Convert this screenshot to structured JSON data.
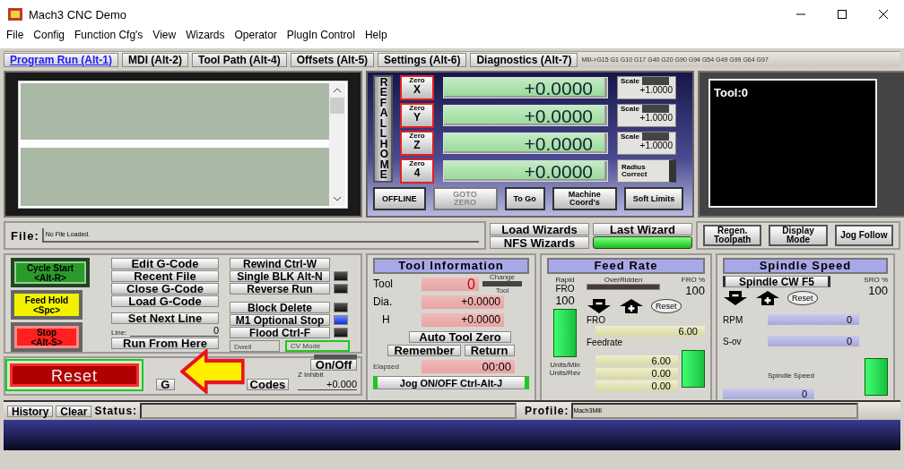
{
  "window": {
    "title": "Mach3 CNC  Demo"
  },
  "menu": [
    "File",
    "Config",
    "Function Cfg's",
    "View",
    "Wizards",
    "Operator",
    "PlugIn Control",
    "Help"
  ],
  "tabs": [
    {
      "label": "Program Run (Alt-1)",
      "selected": true
    },
    {
      "label": "MDI (Alt-2)",
      "selected": false
    },
    {
      "label": "Tool Path (Alt-4)",
      "selected": false
    },
    {
      "label": "Offsets (Alt-5)",
      "selected": false
    },
    {
      "label": "Settings (Alt-6)",
      "selected": false
    },
    {
      "label": "Diagnostics (Alt-7)",
      "selected": false
    }
  ],
  "modal_codes": "Mill->G15  G1 G10 G17 G40 G20 G90 G94 G54 G49 G99 G64 G97",
  "ref_all_home": "REF ALL HOME",
  "axes": [
    {
      "zero": "Zero",
      "axis": "X",
      "value": "+0.0000",
      "kind": "scale",
      "label": "Scale",
      "scale": "+1.0000"
    },
    {
      "zero": "Zero",
      "axis": "Y",
      "value": "+0.0000",
      "kind": "scale",
      "label": "Scale",
      "scale": "+1.0000"
    },
    {
      "zero": "Zero",
      "axis": "Z",
      "value": "+0.0000",
      "kind": "scale",
      "label": "Scale",
      "scale": "+1.0000"
    },
    {
      "zero": "Zero",
      "axis": "4",
      "value": "+0.0000",
      "kind": "radius",
      "label": "Radius Correct"
    }
  ],
  "dro_buttons": [
    {
      "label": "OFFLINE",
      "disabled": false
    },
    {
      "label": "GOTO ZERO",
      "disabled": true
    },
    {
      "label": "To Go",
      "disabled": false
    },
    {
      "label": "Machine Coord's",
      "disabled": false
    },
    {
      "label": "Soft Limits",
      "disabled": false
    }
  ],
  "tool_display": "Tool:0",
  "file": {
    "label": "File:",
    "value": "No File Loaded."
  },
  "wizards": [
    "Load Wizards",
    "Last Wizard",
    "NFS Wizards"
  ],
  "view_buttons": [
    "Regen. Toolpath",
    "Display Mode",
    "Jog Follow"
  ],
  "program_buttons": [
    {
      "kind": "start",
      "lines": [
        "Cycle Start",
        "<Alt-R>"
      ]
    },
    {
      "kind": "hold",
      "lines": [
        "Feed Hold",
        "<Spc>"
      ]
    },
    {
      "kind": "stop",
      "lines": [
        "Stop",
        "<Alt-S>"
      ]
    }
  ],
  "gcode_buttons": [
    "Edit G-Code",
    "Recent File",
    "Close G-Code",
    "Load G-Code"
  ],
  "set_next_line": "Set Next Line",
  "line": {
    "label": "Line:",
    "value": "0"
  },
  "run_from_here": "Run From Here",
  "toggles_top": [
    {
      "label": "Rewind Ctrl-W",
      "kind": "button"
    },
    {
      "label": "Single BLK Alt-N",
      "kind": "toggle",
      "on": false
    },
    {
      "label": "Reverse Run",
      "kind": "toggle",
      "on": false
    }
  ],
  "toggles_bottom": [
    {
      "label": "Block Delete",
      "kind": "toggle",
      "on": false
    },
    {
      "label": "M1 Optional Stop",
      "kind": "toggle",
      "on": true
    },
    {
      "label": "Flood Ctrl-F",
      "kind": "toggle",
      "on": false
    }
  ],
  "indicators": [
    {
      "label": "Dwell",
      "on": false
    },
    {
      "label": "CV Mode",
      "on": true
    }
  ],
  "reset": "Reset",
  "partial_buttons": [
    "G",
    "Codes"
  ],
  "z_inhibit": {
    "button": "On/Off",
    "label": "Z Inhibit",
    "value": "+0.000"
  },
  "tool_info": {
    "title": "Tool Information",
    "tool_label": "Tool",
    "tool": "0",
    "change_top": "Change",
    "change_bottom": "Tool",
    "dia_label": "Dia.",
    "dia": "+0.0000",
    "h_label": "H",
    "h": "+0.0000",
    "auto_zero": "Auto Tool Zero",
    "remember": "Remember",
    "return": "Return",
    "elapsed_label": "Elapsed",
    "elapsed": "00:00",
    "jog": "Jog ON/OFF Ctrl-Alt-J"
  },
  "feed_rate": {
    "title": "Feed Rate",
    "overridden": "OverRidden",
    "fro_pct_label": "FRO %",
    "fro_pct": "100",
    "rapid_label": "Rapid",
    "rapid_fro_label": "FRO",
    "rapid": "100",
    "rapid_slider": {
      "level": 1
    },
    "feed_slider": {
      "level": 1
    },
    "reset": "Reset",
    "fro_label": "FRO",
    "fro": "6.00",
    "feedrate_label": "Feedrate",
    "feedrate": "6.00",
    "units_min_label": "Units/Min",
    "units_min": "0.00",
    "units_rev_label": "Units/Rev",
    "units_rev": "0.00"
  },
  "spindle": {
    "title": "Spindle Speed",
    "cw": "Spindle CW F5",
    "sro_label": "SRO %",
    "sro": "100",
    "reset": "Reset",
    "rpm_label": "RPM",
    "rpm": "0",
    "sov_label": "S-ov",
    "sov": "0",
    "speed_label": "Spindle Speed",
    "speed": "0",
    "slider": {
      "level": 1
    }
  },
  "status_bar": {
    "history": "History",
    "clear": "Clear",
    "status_label": "Status:",
    "profile_label": "Profile:",
    "profile": "Mach3Mill"
  }
}
